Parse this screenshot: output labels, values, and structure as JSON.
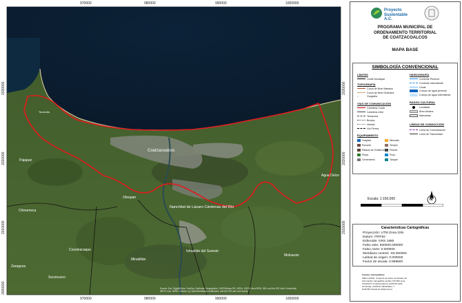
{
  "map": {
    "easting_labels": [
      "970000",
      "980000",
      "990000",
      "1000000"
    ],
    "northing_labels": [
      "2030000",
      "2020000",
      "2010000",
      "2000000"
    ],
    "places": [
      {
        "name": "Coatzacoalcos"
      },
      {
        "name": "Nanchital de Lázaro Cárdenas del Río"
      },
      {
        "name": "Agua Dulce"
      },
      {
        "name": "Pajapan"
      },
      {
        "name": "Chinameca"
      },
      {
        "name": "Minatitlán"
      },
      {
        "name": "Oteapan"
      },
      {
        "name": "Zaragoza"
      },
      {
        "name": "Ixhuatlán del Sureste"
      },
      {
        "name": "Moloacán"
      },
      {
        "name": "Cosoleacaque"
      },
      {
        "name": "Soconusco"
      },
      {
        "name": "Tecolutla"
      }
    ],
    "attribution_line1": "Source: Esri, DigitalGlobe, GeoEye, Earthstar Geographics, CNES/Airbus DS, USDA, USGS, AeroGRID, IGN, and the GIS User Community",
    "attribution_line2": "INEGI, Esri, HERE, Garmin, (c) OpenStreetMap contributors, and the GIS user community"
  },
  "panel": {
    "logo_text": [
      "Proyecto",
      "Sustentable A.C."
    ],
    "title": [
      "PROGRAMA MUNICIPAL DE",
      "ORDENAMIENTO TERRITORIAL",
      "DE COATZACOALCOS"
    ],
    "subtitle": "MAPA BASE",
    "legend": {
      "title": "SIMBOLOGÍA CONVENCIONAL",
      "limites": {
        "head": "LÍMITES",
        "items": [
          "Límite Municipal"
        ]
      },
      "topografia": {
        "head": "TOPOGRAFÍA",
        "items": [
          "Curva de Nivel Maestra",
          "Curva de Nivel Ordinaria",
          "Orografía"
        ]
      },
      "vias": {
        "head": "VÍAS DE COMUNICACIÓN",
        "items": [
          "Carretera Cuota",
          "Carretera Libre",
          "Terracería",
          "Brecha",
          "Vereda",
          "Vía Férrea"
        ]
      },
      "equipamiento": {
        "head": "EQUIPAMIENTO",
        "items": [
          "Hospital",
          "Escuela",
          "Palacio de Gobierno",
          "Plaza",
          "Cementerio",
          "Mercado",
          "Templo",
          "Puente",
          "Pozo",
          "Tanque"
        ]
      },
      "hidrografia": {
        "head": "HIDROGRAFÍA",
        "items": [
          "Corriente Perenne",
          "Corriente Intermitente",
          "Canal",
          "Cuerpo de agua perenne",
          "Cuerpo de agua intermitente"
        ]
      },
      "rasgo": {
        "head": "RASGO CULTURAL",
        "items": [
          "Localidad",
          "Área Urbana",
          "Manzanas"
        ]
      },
      "conduccion": {
        "head": "LÍNEAS DE CONDUCCIÓN",
        "items": [
          "Línea de Comunicación",
          "Línea de Transmisión"
        ]
      }
    },
    "north_letter": "N",
    "scale": "Escala:  1:150,000",
    "cart_title": "Características Cartográficas",
    "cart_lines": [
      "Proyección: UTM Zona 15N",
      "Datum:  ITRF92",
      "Esferoide:  GRS 1980",
      "Falso este: 500000.000000",
      "Falso norte: 0.000000",
      "Meridiano central: -93.000000",
      "Latitud de origen: 0.000000",
      "Factor de escala: 0.999600"
    ],
    "sources": [
      "Fuentes Cartográficas",
      "INEGI (2015). Conjunto de datos vectoriales de",
      "información topográfica escala 1:50,000 serie",
      "III E15C47 (Coatzacoalcos); E15C46 (Villa",
      "Tecolutla) y E15C57 (Minatitlán). Y",
      "E15C58 (Tonalá de Matamoros)"
    ],
    "colors": {
      "boundary": "#e31a1c",
      "sea": "#0d1f33",
      "land": "#4f6a34"
    }
  }
}
